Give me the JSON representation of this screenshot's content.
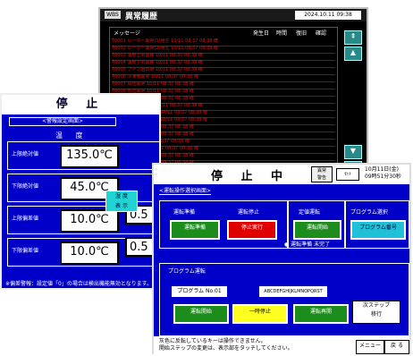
{
  "history": {
    "tag": "WBS",
    "title": "異常履歴",
    "datetime": "2024.10.11 09:38",
    "headers": [
      "メッセージ",
      "発生日",
      "時間",
      "復旧",
      "確認"
    ],
    "rows": [
      "T0001 ヒーター異常(1)発生    10/11 08:37 08:38 確",
      "T0002 ヒーター異常(2)発生    10/11 08:37 08:38 確",
      "T0003 温度上限警報           10/11 08:37 08:38 確",
      "T0004 温度下限警報           10/11 08:37 08:38 確",
      "T0005 ファン過負荷            10/11 08:37 08:38 確",
      "T0006 冷凍機異常              10/11 08:37 08:38 確",
      "T0007 高圧異常                10/11 08:37 08:38 確",
      "T0008 低圧異常                10/11 08:37 08:38 確",
      "T0009 断水異常                10/11 08:37 08:38 確",
      "T0010 センサー異常            10/11 08:37 08:38 確",
      "T0011 過昇防止器作動          10/11 08:37 08:38 確",
      "T0012 漏電遮断器作動          10/11 08:37 08:38 確",
      "T0013 停電復帰                10/11 08:37 08:38 確",
      "T0014 通信異常                10/11 08:37 08:38 確",
      "T0015 扉開放                  10/11 08:37 08:38 確",
      "T0016 加湿器異常              10/11 08:37 08:38 確",
      "T0017 水位低下                10/11 08:37 08:38 確",
      "T0018 除湿異常                10/11 08:37 08:38 確",
      "T0019 温度偏差警報            10/11 08:37 08:38 確",
      "T0020 湿度偏差警報            10/11 08:37 08:38 確"
    ],
    "scroll_icons": [
      "⇞",
      "▲",
      "▼",
      "⇟"
    ]
  },
  "left": {
    "status": "停 止",
    "subtitle": "<警報設定画面>",
    "column": "温 度",
    "rows": [
      {
        "label": "上限絶対値",
        "value": "135.0℃",
        "value2": ""
      },
      {
        "label": "下限絶対値",
        "value": "45.0℃",
        "value2": ""
      },
      {
        "label": "上限偏差値",
        "value": "10.0℃",
        "value2": "0.5"
      },
      {
        "label": "下限偏差値",
        "value": "10.0℃",
        "value2": "0.5"
      }
    ],
    "note": "※偏差警報：設定値「0」の場合は検出機能無効となります。",
    "cyan_button": "湿 度\n表 示"
  },
  "front": {
    "status": "停 止 中",
    "alarm_button": "異常\n警告",
    "set_button": "ｾｯﾄ",
    "date": "10月11日(金)\n09時51分30秒",
    "subtitle": "<運転操作選択画面>",
    "sections": {
      "prep_label": "運転準備",
      "prep_button": "運転準備",
      "stop_label": "運転停止",
      "stop_button": "停止実行",
      "const_label": "定値運転",
      "const_button": "運転開始",
      "const_note": "運転準備 未完了",
      "prog_sel_label": "プログラム選択",
      "prog_sel_button": "プログラム番号"
    },
    "program": {
      "label": "プログラム運転",
      "name": "プログラム No.01",
      "code": "ABCDEFGHIJKLMNOPQRST",
      "start": "運転開始",
      "pause": "一時停止",
      "resume": "運転再開",
      "next_step": "次ステップ\n移行"
    },
    "footer": {
      "message1": "灰色に反転しているキーは操作できません。",
      "message2": "開始ステップの変更は、表示部をタッチしてください。",
      "menu": "メニュー",
      "back": "戻 る"
    }
  }
}
